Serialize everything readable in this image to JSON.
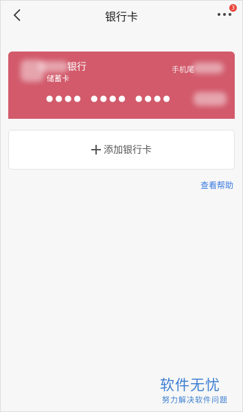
{
  "header": {
    "title": "银行卡",
    "back_icon": "chevron-left-icon",
    "more_icon": "more-dots-icon",
    "badge_count": "3"
  },
  "bank_card": {
    "bank_name": "银行",
    "card_type": "储蓄卡",
    "phone_label": "手机尾",
    "masked_groups": [
      "●●●●",
      "●●●●",
      "●●●●"
    ],
    "background_color": "#d25a6b"
  },
  "add_card": {
    "label": "添加银行卡",
    "icon": "plus-icon"
  },
  "help_link": "查看帮助",
  "watermark": {
    "title": "软件无忧",
    "subtitle": "努力解决软件问题"
  }
}
